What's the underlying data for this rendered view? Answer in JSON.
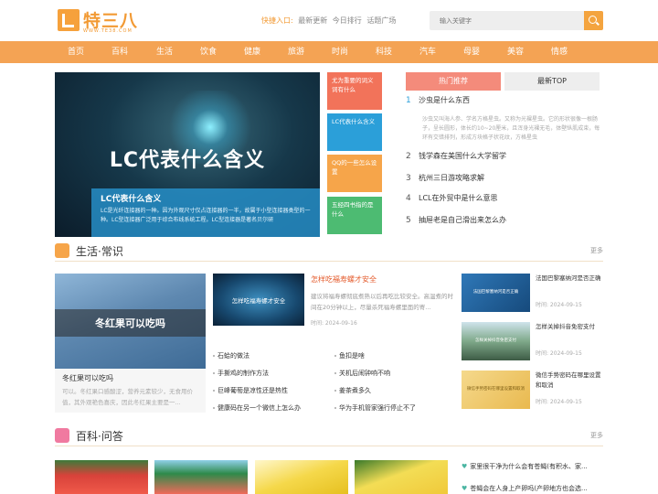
{
  "site": {
    "logo": "特三八",
    "logo_sub": "WWW.TE38.COM"
  },
  "quick": {
    "label": "快捷入口:",
    "links": [
      "最新更新",
      "今日排行",
      "话题广场"
    ]
  },
  "search": {
    "placeholder": "输入关键字"
  },
  "nav": [
    "首页",
    "百科",
    "生活",
    "饮食",
    "健康",
    "旅游",
    "时尚",
    "科技",
    "汽车",
    "母婴",
    "美容",
    "情感"
  ],
  "hero": {
    "image_text": "LC代表什么含义",
    "caption_title": "LC代表什么含义",
    "caption_desc": "LC是光纤连接器的一种。因为外观尺寸仅占连接器的一半，故属于小型连接器类型的一种。LC型连接器广泛用于综合布线系统工程。LC型连接器是著名贝尔研"
  },
  "tiles": [
    {
      "text": "尤为重要的词义词有什么",
      "color": "#f2735a"
    },
    {
      "text": "LC代表什么含义",
      "color": "#2b9fd9"
    },
    {
      "text": "QQ的一些怎么设置",
      "color": "#f6a54a"
    },
    {
      "text": "五经四书指的是什么",
      "color": "#4dbb72"
    }
  ],
  "hot": {
    "tab_active": "热门推荐",
    "tab_other": "最新TOP",
    "items": [
      {
        "n": "1",
        "title": "沙虫是什么东西"
      },
      {
        "n": "2",
        "title": "钱学森在美国什么大学留学"
      },
      {
        "n": "3",
        "title": "杭州三日游攻略求解"
      },
      {
        "n": "4",
        "title": "LCL在外贸中是什么意思"
      },
      {
        "n": "5",
        "title": "抽屉老是自己滑出来怎么办"
      }
    ],
    "first_desc": "沙虫又叫海人参、学名方格星虫。又称为光裸星虫。它的形状很像一根肠子，呈长圆形，体长约10~20厘米，且浑身光裸无毛，体壁纵肌成束，每环有交错排列，形成方块格子状花纹，方格星虫"
  },
  "life": {
    "title": "生活·常识",
    "more": "更多",
    "card": {
      "image_text": "冬红果可以吃吗",
      "title": "冬红果可以吃吗",
      "desc": "可以。冬红果口感酸涩，营养元素较少，无食用价值，其外观艳色喜庆，因此冬红果主要是一..."
    },
    "feature": {
      "image_text": "怎样吃福寿螺才安全",
      "title": "怎样吃福寿螺才安全",
      "desc": "建议将福寿螺彻底煮熟以后再吃比较安全。高温煮的时间在20分钟以上，尽量杀死福寿螺里面的寄...",
      "time": "时间: 2024-09-16"
    },
    "list": [
      "石蛤的做法",
      "鱼扣是啥",
      "手撕鸡的制作方法",
      "关机后闹钟响不响",
      "巨峰葡萄是凉性还是热性",
      "姜茶煮多久",
      "健康码在另一个微信上怎么办",
      "华为手机管家强行停止不了"
    ],
    "side": [
      {
        "image_text": "法国巴黎塞纳河是否正确",
        "title": "法国巴黎塞纳河是否正确",
        "time": "时间: 2024-09-15"
      },
      {
        "image_text": "怎样关掉抖音免密支付",
        "title": "怎样关掉抖音免密支付",
        "time": "时间: 2024-09-15"
      },
      {
        "image_text": "微信手势密码在哪里设置和取消",
        "title": "微信手势密码在哪里设置和取消",
        "time": "时间: 2024-09-15"
      }
    ]
  },
  "qa": {
    "title": "百科·问答",
    "more": "更多",
    "items": [
      "家里很干净为什么会有苍蝇(有积水、家...",
      "苍蝇会在人身上产卵吗(产卵地方也会选..."
    ]
  }
}
